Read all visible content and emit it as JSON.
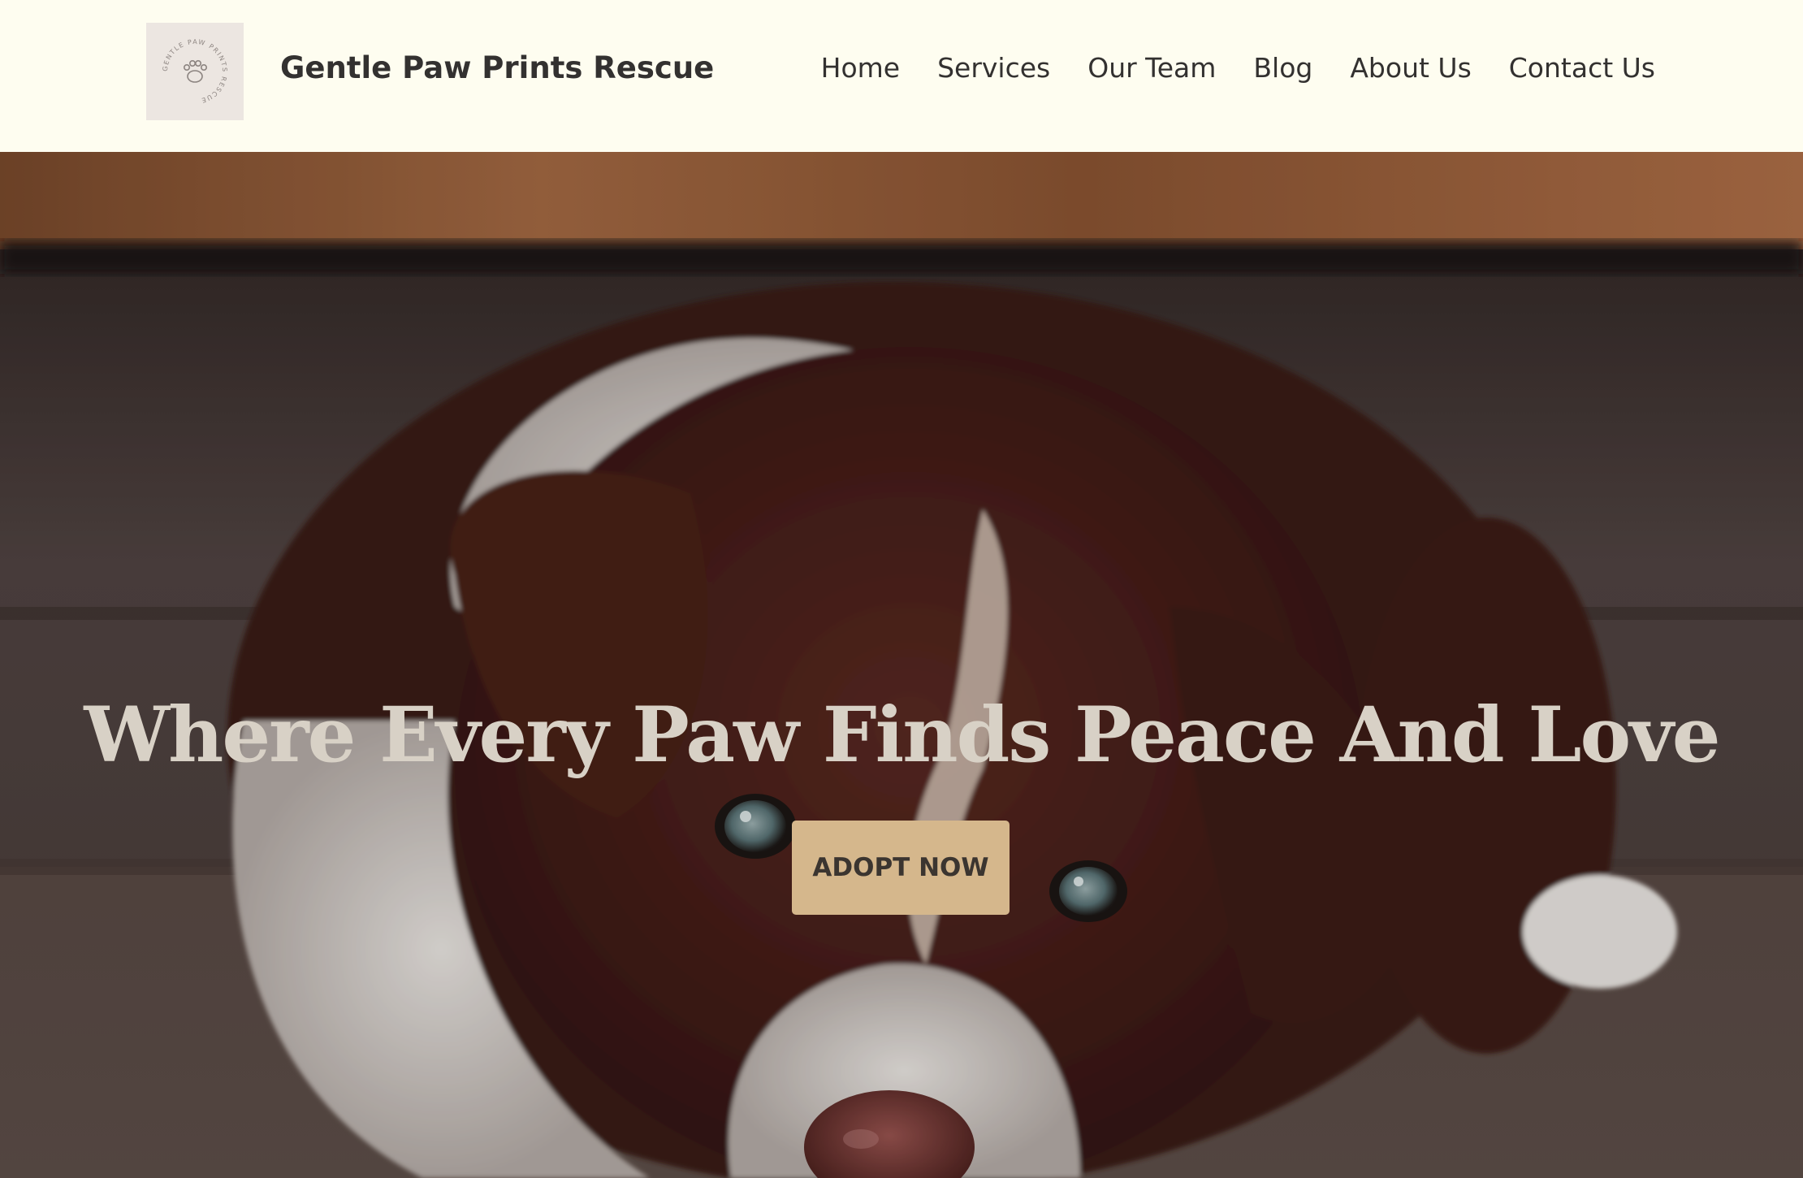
{
  "brand": {
    "logo_text": "GENTLE PAW PRINTS RESCUE",
    "site_title": "Gentle Paw Prints Rescue"
  },
  "nav": {
    "items": [
      {
        "label": "Home"
      },
      {
        "label": "Services"
      },
      {
        "label": "Our Team"
      },
      {
        "label": "Blog"
      },
      {
        "label": "About Us"
      },
      {
        "label": "Contact Us"
      }
    ]
  },
  "hero": {
    "headline": "Where Every Paw Finds Peace And Love",
    "cta_label": "ADOPT NOW",
    "image_subject": "brown-and-white-puppy-photo"
  },
  "colors": {
    "header_bg": "#fefdf0",
    "text": "#333130",
    "cta_bg": "#d5b78c",
    "headline": "#d8d1c6"
  }
}
